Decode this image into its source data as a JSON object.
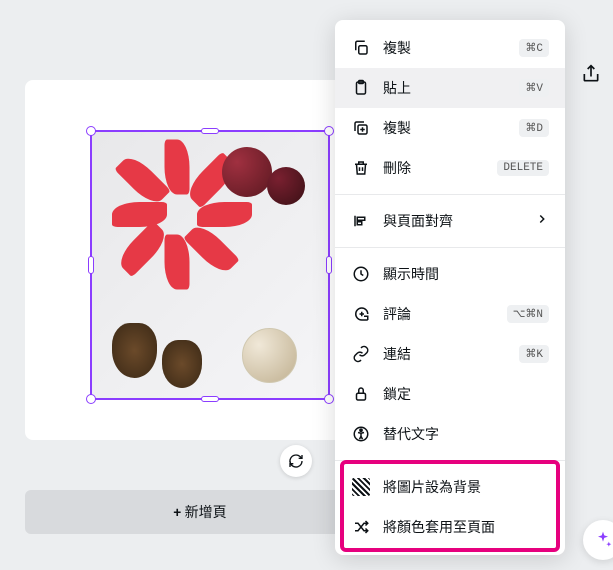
{
  "menu": {
    "copy": {
      "label": "複製",
      "shortcut": "⌘C"
    },
    "paste": {
      "label": "貼上",
      "shortcut": "⌘V"
    },
    "duplicate": {
      "label": "複製",
      "shortcut": "⌘D"
    },
    "delete": {
      "label": "刪除",
      "shortcut": "DELETE"
    },
    "align": {
      "label": "與頁面對齊"
    },
    "timing": {
      "label": "顯示時間"
    },
    "comment": {
      "label": "評論",
      "shortcut": "⌥⌘N"
    },
    "link": {
      "label": "連結",
      "shortcut": "⌘K"
    },
    "lock": {
      "label": "鎖定"
    },
    "alt": {
      "label": "替代文字"
    },
    "setbg": {
      "label": "將圖片設為背景"
    },
    "applycolor": {
      "label": "將顏色套用至頁面"
    }
  },
  "toolbar": {
    "addPage": "+ 新增頁"
  }
}
